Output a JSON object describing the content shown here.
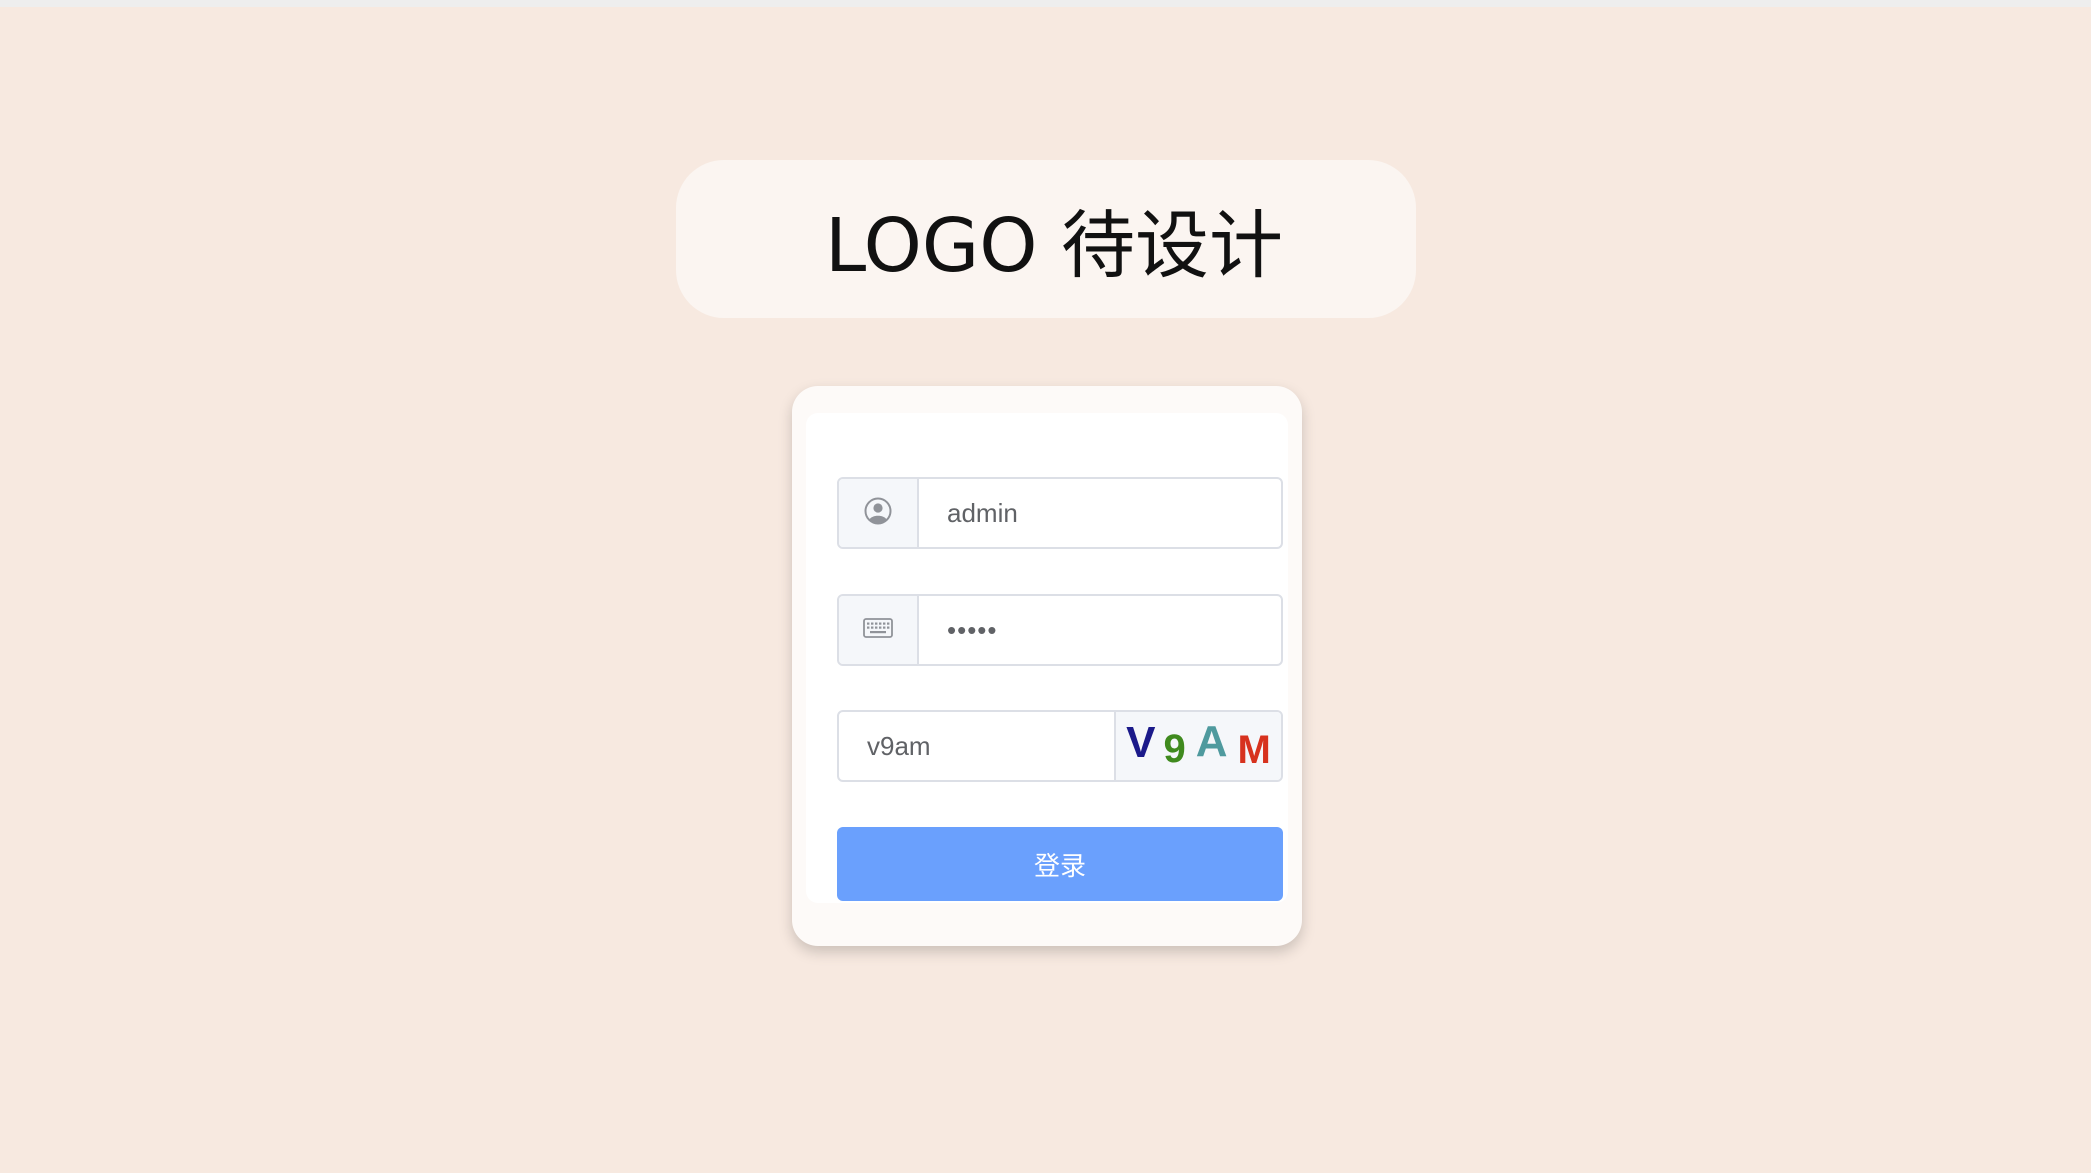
{
  "logo": {
    "text": "LOGO 待设计"
  },
  "form": {
    "username": {
      "icon": "user-circle-icon",
      "value": "admin"
    },
    "password": {
      "icon": "keyboard-icon",
      "value": "•••••"
    },
    "captcha": {
      "value": "v9am",
      "image_chars": [
        {
          "char": "V",
          "color": "#1b1a8a"
        },
        {
          "char": "9",
          "color": "#3f8a1e"
        },
        {
          "char": "A",
          "color": "#4f9a9e"
        },
        {
          "char": "M",
          "color": "#d7321e"
        }
      ]
    },
    "submit_label": "登录"
  },
  "colors": {
    "background": "#f7e9e0",
    "button": "#6aa0fd"
  }
}
